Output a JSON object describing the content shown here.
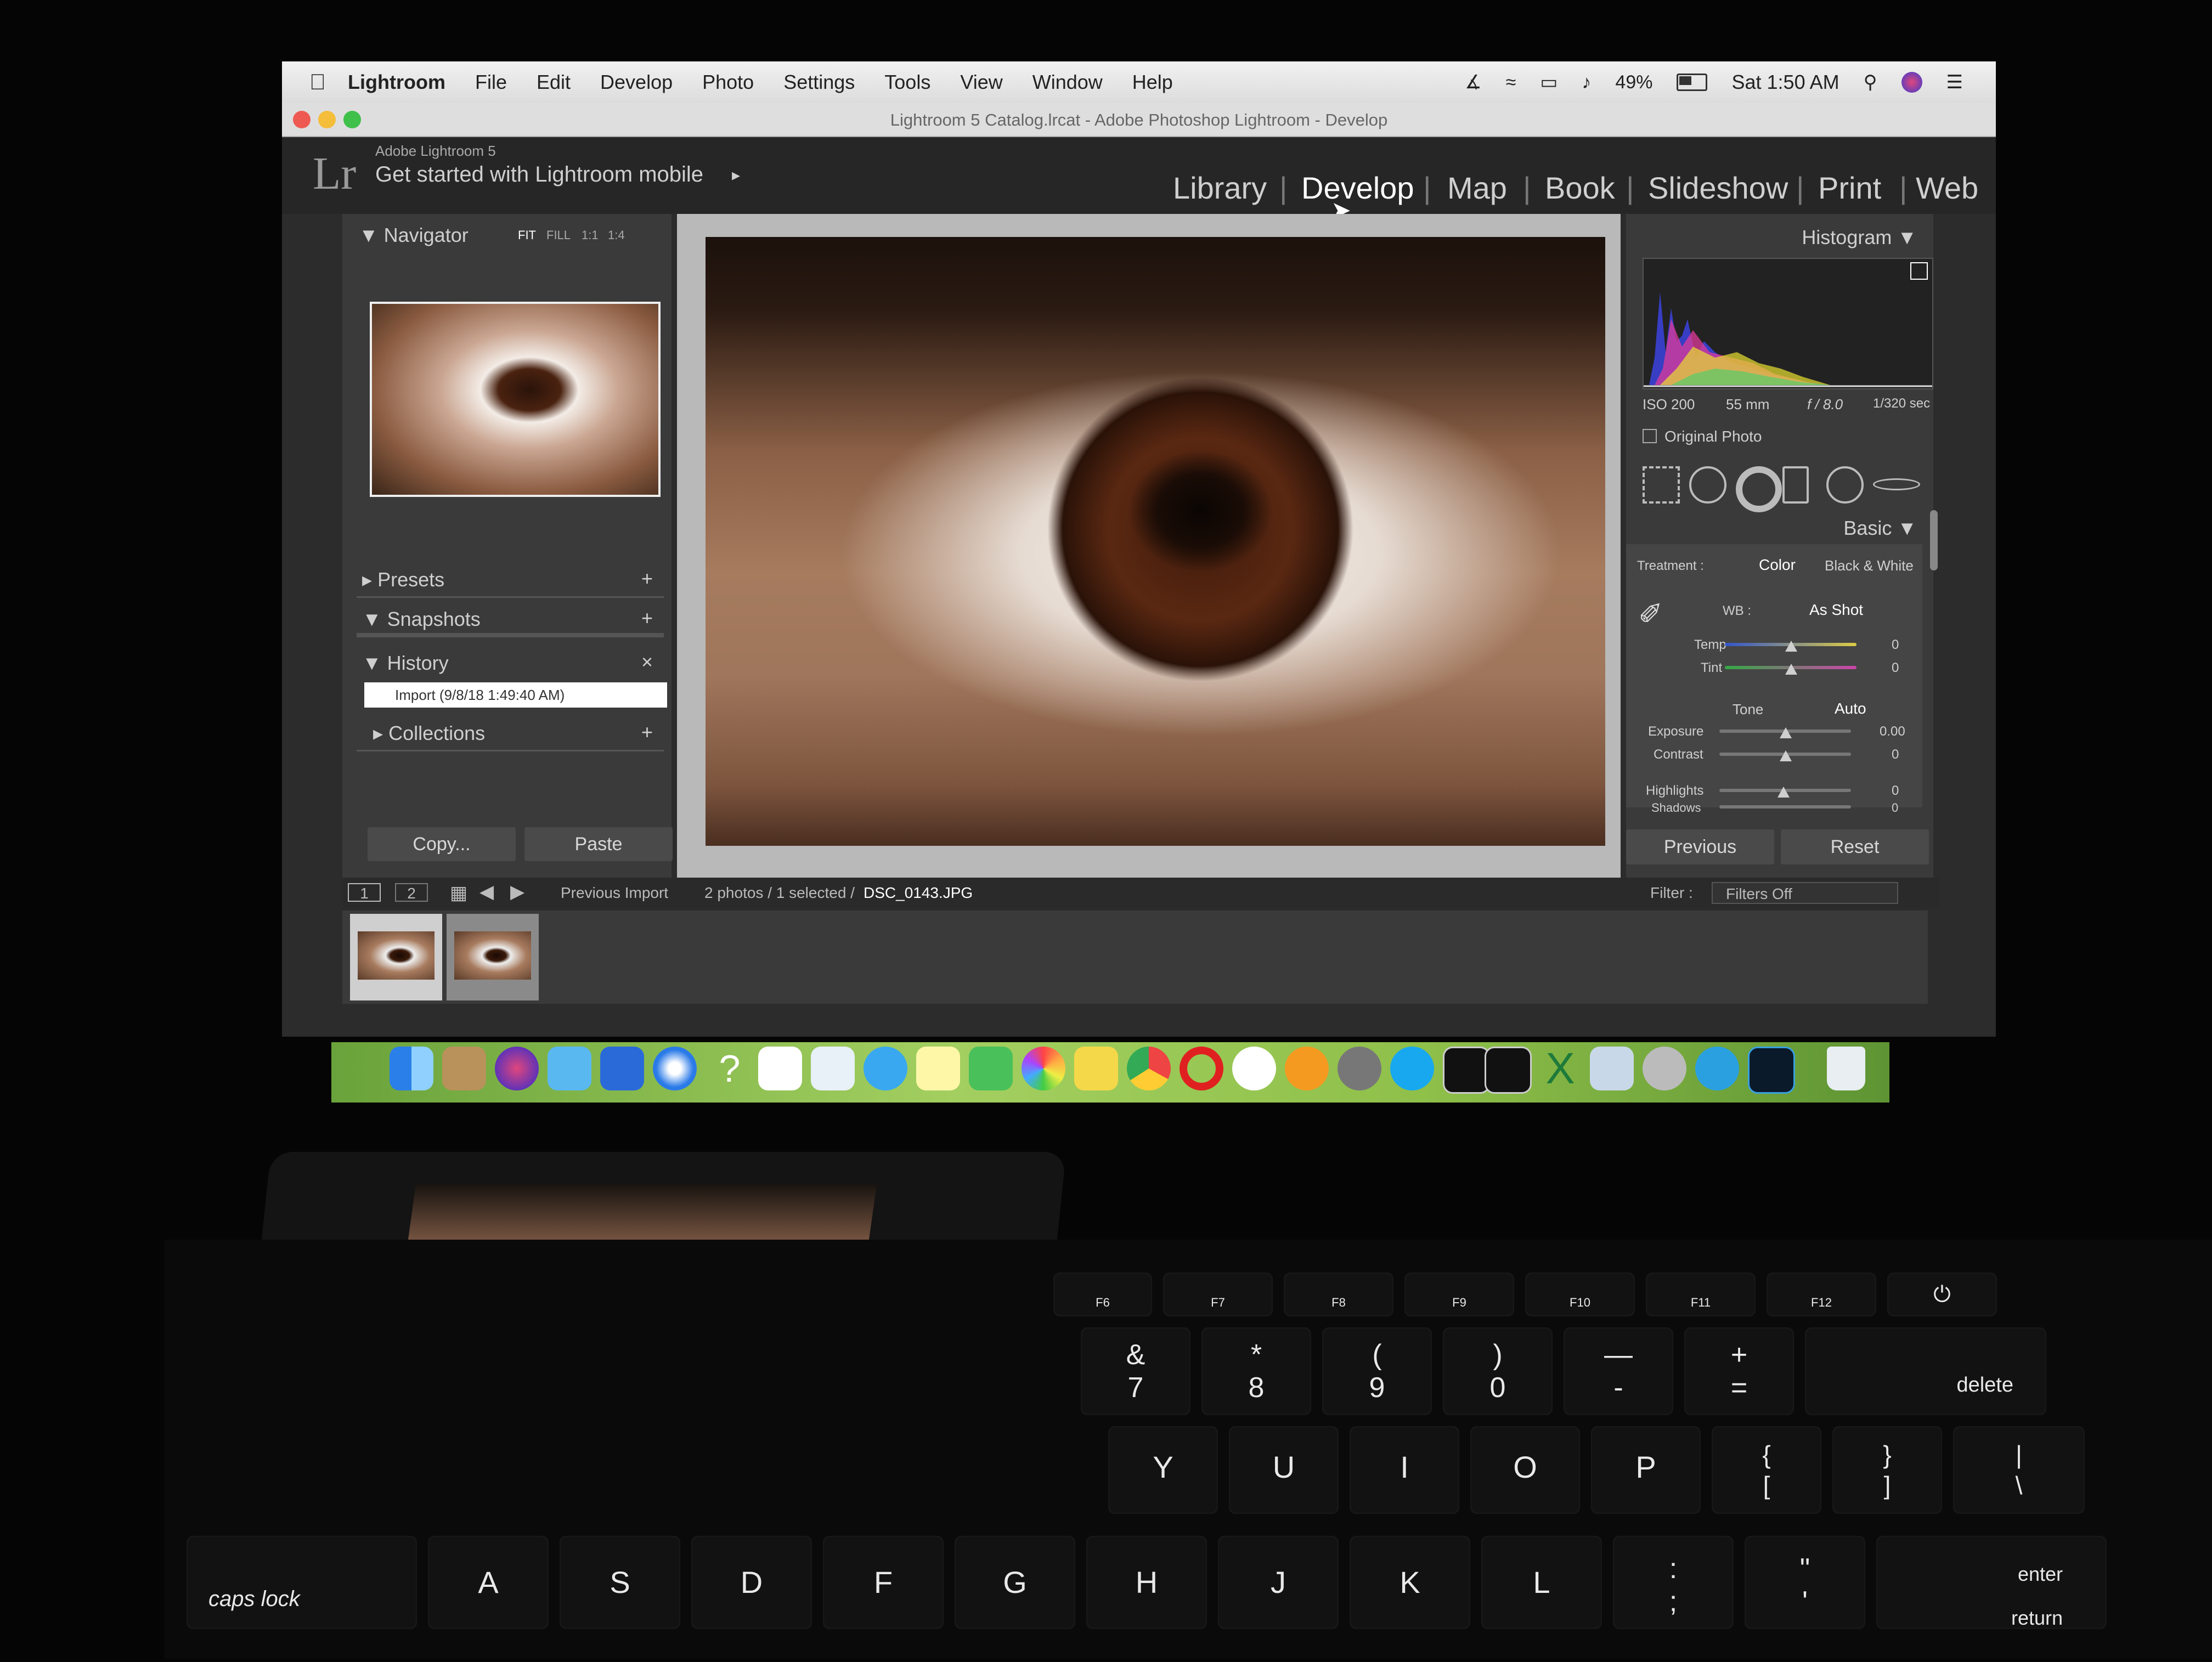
{
  "menubar": {
    "app_name": "Lightroom",
    "items": [
      "File",
      "Edit",
      "Develop",
      "Photo",
      "Settings",
      "Tools",
      "View",
      "Window",
      "Help"
    ],
    "battery": "49%",
    "clock": "Sat 1:50 AM"
  },
  "window": {
    "title": "Lightroom 5 Catalog.lrcat - Adobe Photoshop Lightroom - Develop"
  },
  "identity": {
    "logo": "Lr",
    "product": "Adobe Lightroom 5",
    "mobile_link": "Get started with Lightroom mobile"
  },
  "modules": [
    "Library",
    "Develop",
    "Map",
    "Book",
    "Slideshow",
    "Print",
    "Web"
  ],
  "active_module": "Develop",
  "left_panel": {
    "navigator": {
      "label": "Navigator",
      "zoom": [
        "FIT",
        "FILL",
        "1:1",
        "1:4"
      ]
    },
    "presets": "Presets",
    "snapshots": "Snapshots",
    "history": {
      "label": "History",
      "entry": "Import (9/8/18 1:49:40 AM)"
    },
    "collections": "Collections",
    "copy_button": "Copy...",
    "paste_button": "Paste"
  },
  "right_panel": {
    "histogram": {
      "label": "Histogram",
      "iso": "ISO 200",
      "focal": "55 mm",
      "aperture": "f / 8.0",
      "shutter": "1/320 sec",
      "original_photo": "Original Photo"
    },
    "basic": {
      "label": "Basic",
      "treatment_label": "Treatment :",
      "treatment_color": "Color",
      "treatment_bw": "Black & White",
      "wb_label": "WB :",
      "wb_value": "As Shot",
      "temp_label": "Temp",
      "temp_value": "0",
      "tint_label": "Tint",
      "tint_value": "0",
      "tone_label": "Tone",
      "auto_label": "Auto",
      "exposure_label": "Exposure",
      "exposure_value": "0.00",
      "contrast_label": "Contrast",
      "contrast_value": "0",
      "highlights_label": "Highlights",
      "highlights_value": "0",
      "shadows_label": "Shadows",
      "shadows_value": "0"
    },
    "previous_button": "Previous",
    "reset_button": "Reset"
  },
  "filmstrip": {
    "view1": "1",
    "view2": "2",
    "source": "Previous Import",
    "count": "2 photos / 1 selected /",
    "filename": "DSC_0143.JPG",
    "filter_label": "Filter :",
    "filter_value": "Filters Off"
  },
  "keyboard": {
    "fn_row": [
      "F6",
      "F7",
      "F8",
      "F9",
      "F10",
      "F11",
      "F12"
    ],
    "num_row": [
      {
        "top": "&",
        "bottom": "7"
      },
      {
        "top": "*",
        "bottom": "8"
      },
      {
        "top": "(",
        "bottom": "9"
      },
      {
        "top": ")",
        "bottom": "0"
      },
      {
        "top": "—",
        "bottom": "-"
      },
      {
        "top": "+",
        "bottom": "="
      }
    ],
    "delete": "delete",
    "top_row": [
      "Y",
      "U",
      "I",
      "O",
      "P"
    ],
    "brackets": [
      {
        "top": "{",
        "bottom": "["
      },
      {
        "top": "}",
        "bottom": "]"
      },
      {
        "top": "|",
        "bottom": "\\"
      }
    ],
    "home_row": [
      "A",
      "S",
      "D",
      "F",
      "G",
      "H",
      "J",
      "K",
      "L"
    ],
    "caps_lock": "caps lock",
    "enter": "enter",
    "return": "return"
  },
  "colors": {
    "lr_bg": "#2c2c2c",
    "panel": "#3a3a3a",
    "active_module": "#ffffff",
    "inactive_module": "#cfcfcf",
    "dock_bg": "#8fc04a"
  },
  "icons": [
    "apple-icon",
    "bluetooth-icon",
    "wifi-icon",
    "airplay-icon",
    "volume-icon",
    "battery-icon",
    "spotlight-icon",
    "siri-icon",
    "notification-icon",
    "eyedropper-icon",
    "crop-icon",
    "spot-removal-icon",
    "red-eye-icon",
    "graduated-filter-icon",
    "radial-filter-icon",
    "adjustment-brush-icon",
    "grid-view-icon",
    "prev-arrow-icon",
    "next-arrow-icon",
    "trash-icon"
  ]
}
